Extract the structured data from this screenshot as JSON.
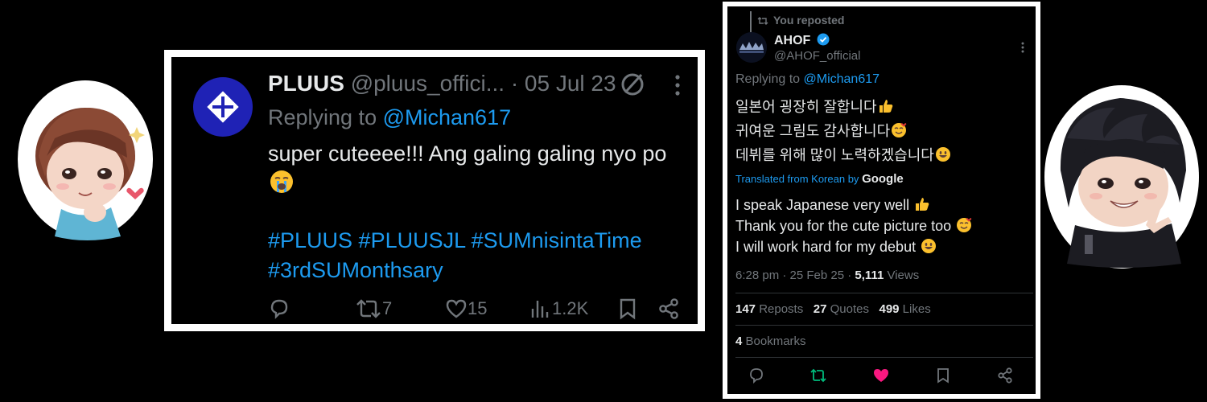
{
  "left_tweet": {
    "display_name": "PLUUS",
    "handle": "@pluus_offici...",
    "date": "· 05 Jul 23",
    "replying_prefix": "Replying to",
    "replying_to": "@Michan617",
    "text": "super cuteeee!!! Ang galing galing nyo po",
    "hashtags_line1": "#PLUUS #PLUUSJL #SUMnisintaTime",
    "hashtags_line2": "#3rdSUMonthsary",
    "retweet_count": "7",
    "like_count": "15",
    "view_count": "1.2K"
  },
  "right_tweet": {
    "repost_label": "You reposted",
    "display_name": "AHOF",
    "handle": "@AHOF_official",
    "replying_prefix": "Replying to",
    "replying_to": "@Michan617",
    "korean_line1": "일본어 굉장히 잘합니다",
    "korean_line2": "귀여운 그림도 감사합니다",
    "korean_line3": "데뷔를 위해 많이 노력하겠습니다",
    "translated_label": "Translated from Korean by",
    "translator": "Google",
    "english_line1": "I speak Japanese very well",
    "english_line2": "Thank you for the cute picture too",
    "english_line3": "I will work hard for my debut",
    "timestamp": "6:28 pm · 25 Feb 25 · ",
    "views_count": "5,111",
    "views_label": " Views",
    "reposts_count": "147",
    "reposts_label": " Reposts",
    "quotes_count": "27",
    "quotes_label": " Quotes",
    "likes_count": "499",
    "likes_label": " Likes",
    "bookmarks_count": "4",
    "bookmarks_label": " Bookmarks"
  },
  "colors": {
    "link_blue": "#1d9bf0",
    "muted_gray": "#71767b",
    "liked_pink": "#f91880",
    "reposted_green": "#00ba7c",
    "pluus_avatar_blue": "#1f22b5"
  },
  "icons": [
    "reply-icon",
    "retweet-icon",
    "like-icon",
    "views-icon",
    "bookmark-icon",
    "share-icon",
    "no-sign-icon",
    "more-icon",
    "verified-icon"
  ]
}
